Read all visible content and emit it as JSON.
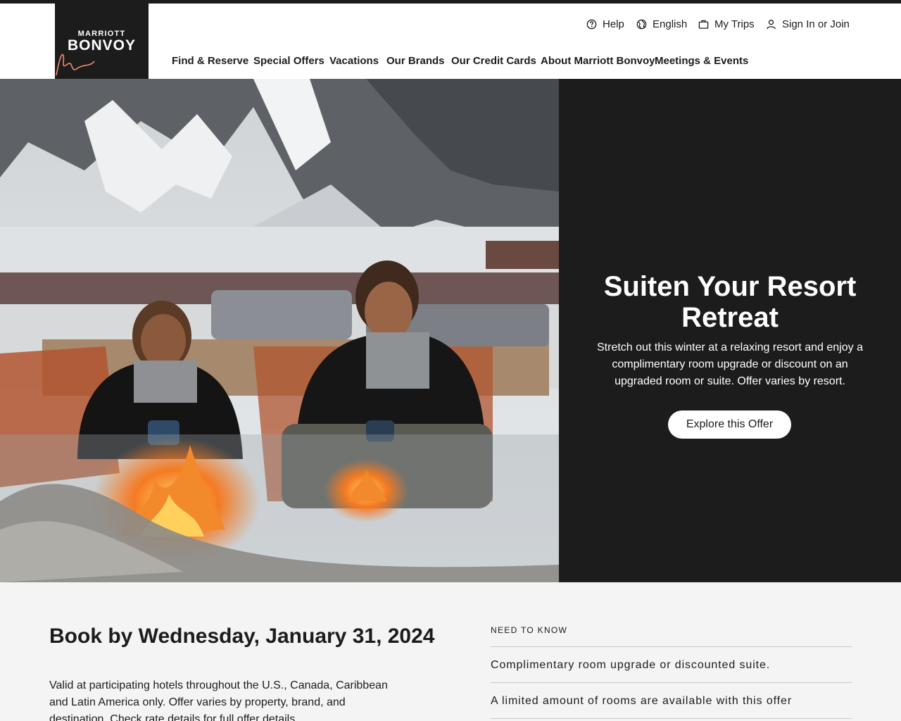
{
  "brand": {
    "logo_line1": "MARRIOTT",
    "logo_line2": "BONVOY",
    "accent_color": "#f58b6c",
    "dark_color": "#1c1c1c"
  },
  "utility_nav": [
    {
      "label": "Help",
      "icon": "help-circle-icon"
    },
    {
      "label": "English",
      "icon": "globe-icon"
    },
    {
      "label": "My Trips",
      "icon": "suitcase-icon"
    },
    {
      "label": "Sign In or Join",
      "icon": "user-icon"
    }
  ],
  "main_nav": [
    {
      "label": "Find & Reserve"
    },
    {
      "label": "Special Offers"
    },
    {
      "label": "Vacations"
    },
    {
      "label": "Our Brands"
    },
    {
      "label": "Our Credit Cards"
    },
    {
      "label": "About Marriott Bonvoy"
    },
    {
      "label": "Meetings & Events"
    }
  ],
  "hero": {
    "title": "Suiten Your Resort Retreat",
    "description": "Stretch out this winter at a relaxing resort and enjoy a complimentary room upgrade or discount on an upgraded room or suite. Offer varies by resort.",
    "cta_label": "Explore this Offer"
  },
  "offer": {
    "book_by": "Book by Wednesday, January 31, 2024",
    "details": "Valid at participating hotels throughout the U.S., Canada, Caribbean and Latin America only. Offer varies by property, brand, and destination. Check rate details for full offer details."
  },
  "need_to_know": {
    "label": "NEED TO KNOW",
    "items": [
      "Complimentary room upgrade or discounted suite.",
      "A limited amount of rooms are available with this offer"
    ]
  }
}
